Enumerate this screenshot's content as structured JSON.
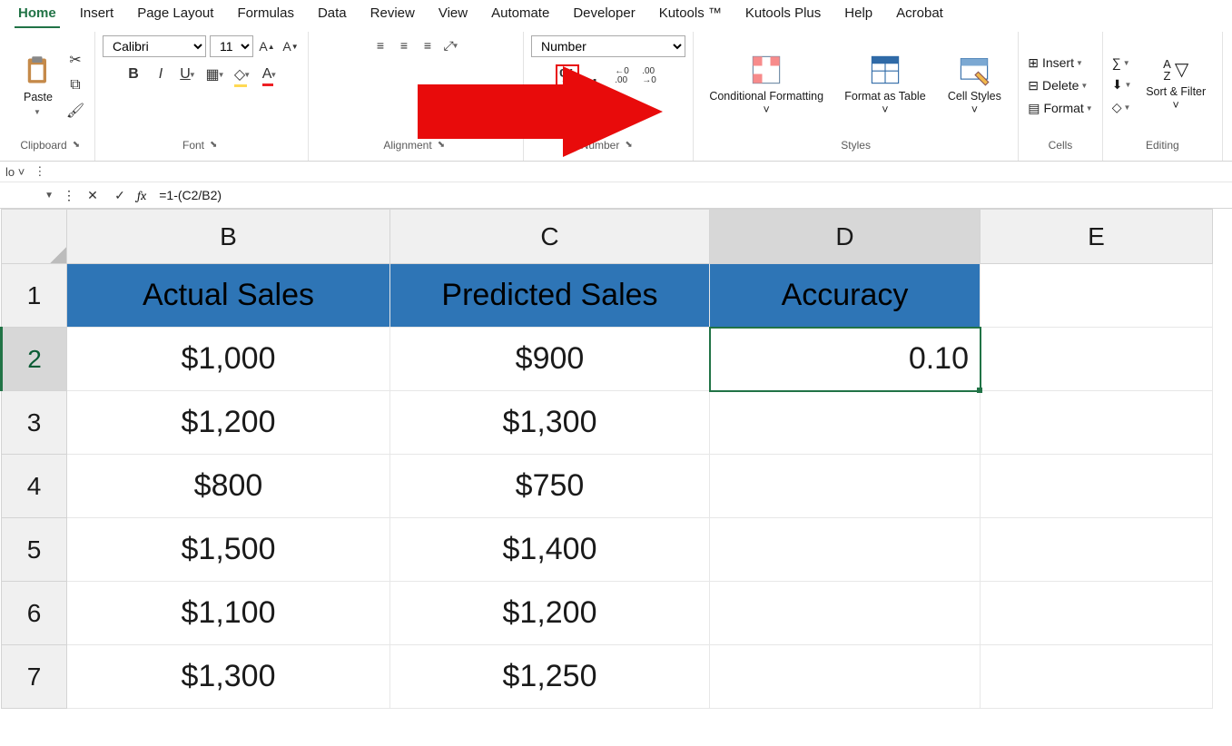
{
  "menu": {
    "items": [
      "Home",
      "Insert",
      "Page Layout",
      "Formulas",
      "Data",
      "Review",
      "View",
      "Automate",
      "Developer",
      "Kutools ™",
      "Kutools Plus",
      "Help",
      "Acrobat"
    ],
    "active": 0
  },
  "ribbon": {
    "font": {
      "name": "Calibri",
      "size": "11"
    },
    "number_format": "Number",
    "groups": {
      "clipboard": "Clipboard",
      "font": "Font",
      "alignment": "Alignment",
      "number": "Number",
      "styles": "Styles",
      "cells": "Cells",
      "editing": "Editing"
    },
    "paste": "Paste",
    "styles": {
      "cond": "Conditional Formatting ˅",
      "fas": "Format as Table ˅",
      "cell": "Cell Styles ˅"
    },
    "cells": {
      "insert": "Insert",
      "delete": "Delete",
      "format": "Format"
    },
    "editing": {
      "sort": "Sort & Filter ˅"
    }
  },
  "formula_bar": {
    "formula": "=1-(C2/B2)"
  },
  "columns": [
    "B",
    "C",
    "D",
    "E"
  ],
  "rows": [
    "1",
    "2",
    "3",
    "4",
    "5",
    "6",
    "7"
  ],
  "headers": {
    "B": "Actual Sales",
    "C": "Predicted Sales",
    "D": "Accuracy"
  },
  "data": {
    "B": [
      "$1,000",
      "$1,200",
      "$800",
      "$1,500",
      "$1,100",
      "$1,300"
    ],
    "C": [
      "$900",
      "$1,300",
      "$750",
      "$1,400",
      "$1,200",
      "$1,250"
    ],
    "D": [
      "0.10",
      "",
      "",
      "",
      "",
      ""
    ]
  },
  "active": {
    "col": "D",
    "row": "2"
  }
}
